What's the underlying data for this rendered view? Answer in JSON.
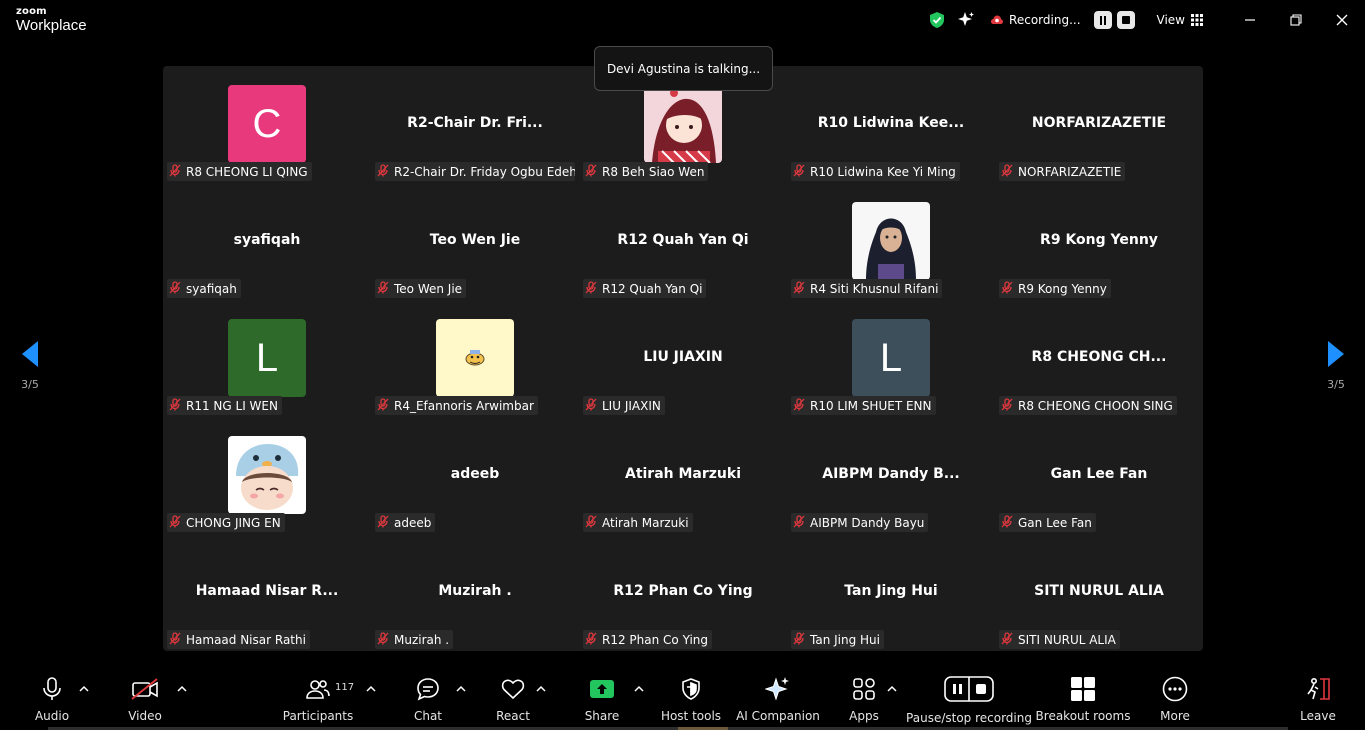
{
  "app": {
    "brand_small": "zoom",
    "brand_name": "Workplace"
  },
  "topbar": {
    "recording_label": "Recording...",
    "view_label": "View"
  },
  "speaker": {
    "talking": "Devi Agustina is talking..."
  },
  "pagination": {
    "left": "3/5",
    "right": "3/5"
  },
  "colors": {
    "accent_blue": "#1e90ff",
    "mic_muted": "#e0383e",
    "share_green": "#22c55e"
  },
  "participants": [
    {
      "label": "R8 CHEONG LI QING",
      "center": "",
      "avatar": {
        "type": "letter",
        "letter": "C",
        "color": "#e8397d"
      }
    },
    {
      "label": "R2-Chair Dr. Friday Ogbu Edeh",
      "center": "R2-Chair  Dr. Fri...",
      "avatar": null
    },
    {
      "label": "R8 Beh Siao Wen",
      "center": "",
      "avatar": {
        "type": "image",
        "icon": "anime-girl-avatar"
      }
    },
    {
      "label": "R10 Lidwina Kee Yi Ming",
      "center": "R10  Lidwina  Kee...",
      "avatar": null
    },
    {
      "label": "NORFARIZAZETIE",
      "center": "NORFARIZAZETIE",
      "avatar": null
    },
    {
      "label": "syafiqah",
      "center": "syafiqah",
      "avatar": null
    },
    {
      "label": "Teo Wen Jie",
      "center": "Teo Wen Jie",
      "avatar": null
    },
    {
      "label": "R12 Quah Yan Qi",
      "center": "R12 Quah Yan Qi",
      "avatar": null
    },
    {
      "label": "R4 Siti Khusnul Rifani",
      "center": "",
      "avatar": {
        "type": "image",
        "icon": "hijab-woman-photo"
      }
    },
    {
      "label": "R9 Kong Yenny",
      "center": "R9 Kong Yenny",
      "avatar": null
    },
    {
      "label": "R11 NG LI WEN",
      "center": "",
      "avatar": {
        "type": "letter",
        "letter": "L",
        "color": "#2e6b2a"
      }
    },
    {
      "label": "R4_Efannoris Arwimbar",
      "center": "",
      "avatar": {
        "type": "image",
        "icon": "cartoon-sticker"
      }
    },
    {
      "label": "LIU JIAXIN",
      "center": "LIU JIAXIN",
      "avatar": null
    },
    {
      "label": "R10 LIM SHUET ENN",
      "center": "",
      "avatar": {
        "type": "letter",
        "letter": "L",
        "color": "#3e4f5c"
      }
    },
    {
      "label": "R8 CHEONG CHOON SING",
      "center": "R8  CHEONG  CH...",
      "avatar": null
    },
    {
      "label": "CHONG JING EN",
      "center": "",
      "avatar": {
        "type": "image",
        "icon": "chibi-penguin-hat"
      }
    },
    {
      "label": "adeeb",
      "center": "adeeb",
      "avatar": null
    },
    {
      "label": "Atirah Marzuki",
      "center": "Atirah Marzuki",
      "avatar": null
    },
    {
      "label": "AIBPM Dandy Bayu",
      "center": "AIBPM  Dandy  B...",
      "avatar": null
    },
    {
      "label": "Gan Lee Fan",
      "center": "Gan Lee Fan",
      "avatar": null
    },
    {
      "label": "Hamaad Nisar Rathi",
      "center": "Hamaad  Nisar  R...",
      "avatar": null
    },
    {
      "label": "Muzirah .",
      "center": "Muzirah .",
      "avatar": null
    },
    {
      "label": "R12 Phan Co Ying",
      "center": "R12 Phan Co Ying",
      "avatar": null
    },
    {
      "label": "Tan Jing Hui",
      "center": "Tan Jing Hui",
      "avatar": null
    },
    {
      "label": "SITI NURUL ALIA",
      "center": "SITI NURUL ALIA",
      "avatar": null
    }
  ],
  "toolbar": {
    "audio": "Audio",
    "video": "Video",
    "participants": "Participants",
    "participants_count": "117",
    "chat": "Chat",
    "react": "React",
    "share": "Share",
    "host_tools": "Host tools",
    "ai_companion": "AI Companion",
    "apps": "Apps",
    "pause_recording": "Pause/stop recording",
    "breakout_rooms": "Breakout rooms",
    "more": "More",
    "leave": "Leave"
  }
}
